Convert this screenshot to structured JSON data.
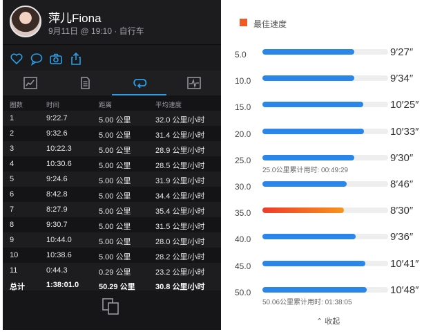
{
  "profile": {
    "name": "萍儿Fiona",
    "meta": "9月11日 @ 19:10 · 自行车"
  },
  "laps": {
    "headers": [
      "圈数",
      "时间",
      "距离",
      "平均速度"
    ],
    "rows": [
      {
        "lap": "1",
        "time": "9:22.7",
        "dist": "5.00 公里",
        "speed": "32.0 公里/小时"
      },
      {
        "lap": "2",
        "time": "9:32.6",
        "dist": "5.00 公里",
        "speed": "31.4 公里/小时"
      },
      {
        "lap": "3",
        "time": "10:22.3",
        "dist": "5.00 公里",
        "speed": "28.9 公里/小时"
      },
      {
        "lap": "4",
        "time": "10:30.6",
        "dist": "5.00 公里",
        "speed": "28.5 公里/小时"
      },
      {
        "lap": "5",
        "time": "9:24.6",
        "dist": "5.00 公里",
        "speed": "31.9 公里/小时"
      },
      {
        "lap": "6",
        "time": "8:42.8",
        "dist": "5.00 公里",
        "speed": "34.4 公里/小时"
      },
      {
        "lap": "7",
        "time": "8:27.9",
        "dist": "5.00 公里",
        "speed": "35.4 公里/小时"
      },
      {
        "lap": "8",
        "time": "9:30.7",
        "dist": "5.00 公里",
        "speed": "31.5 公里/小时"
      },
      {
        "lap": "9",
        "time": "10:44.0",
        "dist": "5.00 公里",
        "speed": "28.0 公里/小时"
      },
      {
        "lap": "10",
        "time": "10:38.6",
        "dist": "5.00 公里",
        "speed": "28.2 公里/小时"
      },
      {
        "lap": "11",
        "time": "0:44.3",
        "dist": "0.29 公里",
        "speed": "23.2 公里/小时"
      }
    ],
    "total": {
      "lap": "总计",
      "time": "1:38:01.0",
      "dist": "50.29 公里",
      "speed": "30.8 公里/小时"
    }
  },
  "splits": {
    "legend": "最佳速度",
    "best_color": "#f15a24",
    "bar_color": "#2a86e8",
    "items": [
      {
        "dist": "5.0",
        "pace": "9′27″",
        "fraction": 0.73,
        "best": false,
        "cum": ""
      },
      {
        "dist": "10.0",
        "pace": "9′34″",
        "fraction": 0.73,
        "best": false,
        "cum": ""
      },
      {
        "dist": "15.0",
        "pace": "10′25″",
        "fraction": 0.8,
        "best": false,
        "cum": ""
      },
      {
        "dist": "20.0",
        "pace": "10′33″",
        "fraction": 0.81,
        "best": false,
        "cum": ""
      },
      {
        "dist": "25.0",
        "pace": "9′30″",
        "fraction": 0.73,
        "best": false,
        "cum": "25.0公里累计用时: 00:49:29"
      },
      {
        "dist": "30.0",
        "pace": "8′46″",
        "fraction": 0.67,
        "best": false,
        "cum": ""
      },
      {
        "dist": "35.0",
        "pace": "8′30″",
        "fraction": 0.65,
        "best": true,
        "cum": ""
      },
      {
        "dist": "40.0",
        "pace": "9′36″",
        "fraction": 0.74,
        "best": false,
        "cum": ""
      },
      {
        "dist": "45.0",
        "pace": "10′41″",
        "fraction": 0.82,
        "best": false,
        "cum": ""
      },
      {
        "dist": "50.0",
        "pace": "10′48″",
        "fraction": 0.83,
        "best": false,
        "cum": "50.06公里累计用时: 01:38:05"
      }
    ],
    "collapse_label": "⌃ 收起"
  }
}
